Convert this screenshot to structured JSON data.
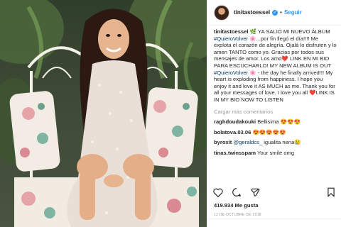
{
  "post": {
    "header": {
      "username": "tinitastoessel",
      "verified_icon": "verified-badge-icon",
      "separator": "•",
      "follow_label": "Seguir"
    },
    "caption": {
      "username": "tinitastoessel",
      "part1": "🌿 YA SALIÓ MI NUEVO ÁLBUM",
      "hashtag1": "#QuieroVolver",
      "part2": "🌸...por fin llegó el día!!!! Me explota el corazón de alegría. Ojalá lo disfruten y lo amen TANTO como yo. Gracias por todos sus mensajes de amor. Los amo❤️ LINK EN MI BIO PARA ESCUCHARLO! MY NEW ALBUM IS OUT",
      "hashtag2": "#QuieroVolver",
      "part3": "🌸 - the day he finally arrived!!! My heart is exploding from happiness. I hope you enjoy it and love it AS MUCH as me. Thank you for all your messages of love. I love you all ❤️LINK IS IN MY BIO NOW TO LISTEN"
    },
    "load_more": "Cargar más comentarios",
    "comments": [
      {
        "user": "raghdoudakouki",
        "text": "Bellisima 😍😍😍"
      },
      {
        "user": "bolatova.03.06",
        "text": "😍😍😍😍😍"
      },
      {
        "user": "byroxit",
        "mention": "@geraldcs_",
        "text": "igualita nena😢"
      },
      {
        "user": "tinas.twinsspam",
        "text": "Your smile omg"
      }
    ],
    "actions": {
      "like_icon": "heart-icon",
      "comment_icon": "comment-icon",
      "share_icon": "share-icon",
      "save_icon": "bookmark-icon"
    },
    "likes": "419.934 Me gusta",
    "date": "12 DE OCTUBRE DE 2018"
  },
  "colors": {
    "link": "#003569",
    "follow": "#3897f0",
    "muted": "#999999",
    "text": "#262626"
  }
}
